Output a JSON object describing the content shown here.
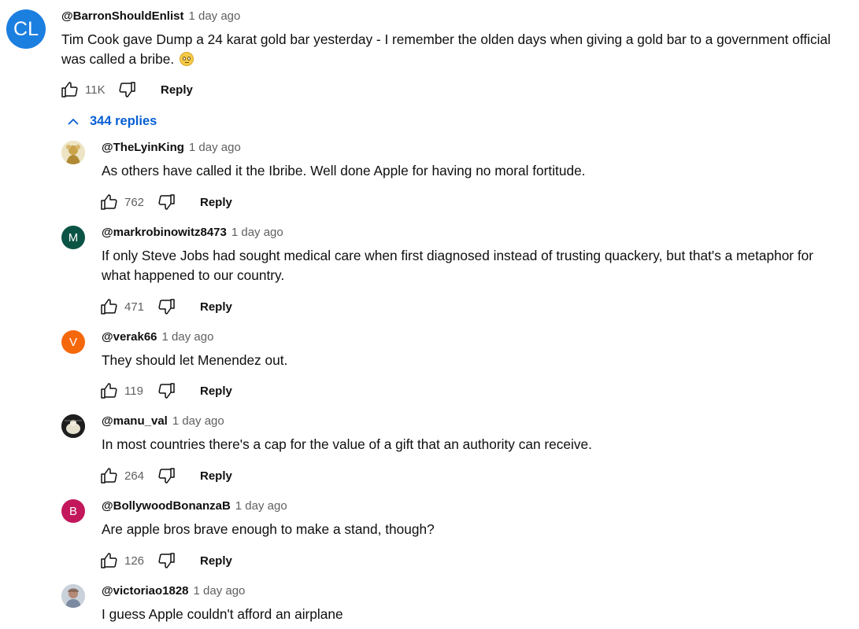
{
  "top_comment": {
    "avatar_initials": "CL",
    "avatar_color": "#1b7fe0",
    "handle": "@BarronShouldEnlist",
    "time": "1 day ago",
    "text": "Tim Cook gave Dump a 24 karat gold bar yesterday - I remember the olden days when giving a gold bar to a government official was called a bribe.",
    "emoji": "face-with-rolling-eyes",
    "likes": "11K",
    "reply_label": "Reply"
  },
  "replies_toggle": {
    "label": "344 replies",
    "icon": "chevron-up-icon",
    "color": "#065fd4"
  },
  "replies": [
    {
      "handle": "@TheLyinKing",
      "time": "1 day ago",
      "text": "As others have called it the Ibribe. Well done Apple for having no moral fortitude.",
      "likes": "762",
      "reply_label": "Reply",
      "avatar_type": "photo"
    },
    {
      "handle": "@markrobinowitz8473",
      "time": "1 day ago",
      "text": "If only Steve Jobs had sought medical care when first diagnosed instead of trusting quackery, but that's a metaphor for what happened to our country.",
      "likes": "471",
      "reply_label": "Reply",
      "avatar_initial": "M",
      "avatar_color": "#0b5345"
    },
    {
      "handle": "@verak66",
      "time": "1 day ago",
      "text": "They should let Menendez out.",
      "likes": "119",
      "reply_label": "Reply",
      "avatar_initial": "V",
      "avatar_color": "#f4680b"
    },
    {
      "handle": "@manu_val",
      "time": "1 day ago",
      "text": "In most countries there's a cap for the value of a gift that an authority can receive.",
      "likes": "264",
      "reply_label": "Reply",
      "avatar_type": "photo"
    },
    {
      "handle": "@BollywoodBonanzaB",
      "time": "1 day ago",
      "text": "Are apple bros brave enough to make a stand, though?",
      "likes": "126",
      "reply_label": "Reply",
      "avatar_initial": "B",
      "avatar_color": "#c2185b"
    },
    {
      "handle": "@victoriao1828",
      "time": "1 day ago",
      "text": "I guess Apple couldn't afford an airplane",
      "avatar_type": "photo"
    }
  ]
}
